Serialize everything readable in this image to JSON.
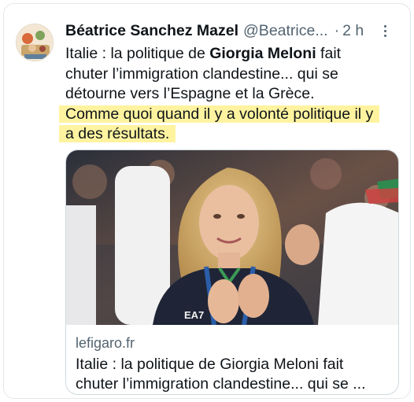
{
  "tweet": {
    "display_name": "Béatrice Sanchez Mazel",
    "handle": "@Beatrice...",
    "separator": "·",
    "timestamp": "2 h",
    "more_icon": "more-icon",
    "text": {
      "line1_a": "Italie : la politique de ",
      "line1_bold": "Giorgia Meloni",
      "line1_b": " fait",
      "line2": "chuter l’immigration clandestine... qui se",
      "line3": "détourne vers l’Espagne et la Grèce.",
      "line4": "Comme quoi quand il y a volonté politique il y",
      "line5": "a des résultats."
    },
    "highlight_color": "#fff3a0"
  },
  "card": {
    "image_icon": "photo-of-woman-applauding",
    "image_text": "EA7",
    "domain": "lefigaro.fr",
    "title_line1": "Italie : la politique de Giorgia Meloni fait",
    "title_line2": "chuter l’immigration clandestine... qui se ..."
  }
}
